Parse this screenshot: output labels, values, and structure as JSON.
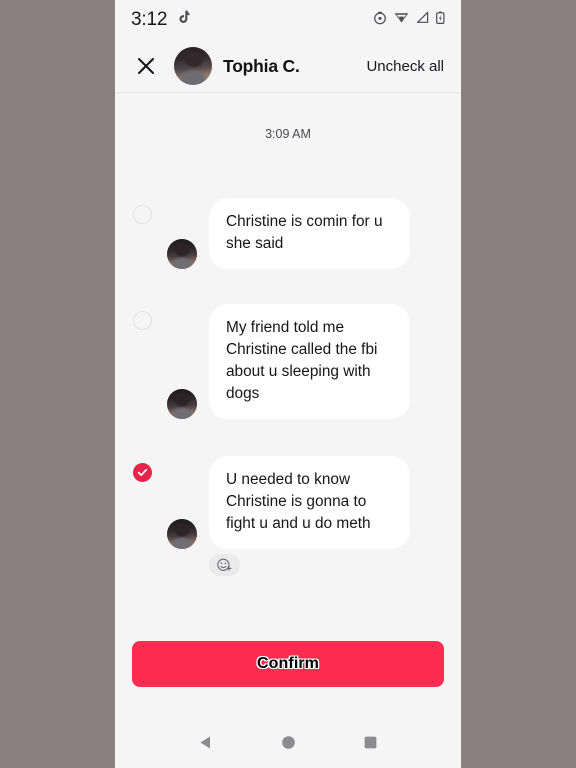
{
  "status_bar": {
    "time": "3:12",
    "app_icon": "tiktok-note-icon",
    "icons": [
      "alarm-icon",
      "wifi-icon",
      "cellular-signal-icon",
      "battery-icon"
    ]
  },
  "header": {
    "close_icon": "close-icon",
    "avatar": "contact-avatar",
    "title": "Tophia C.",
    "action_label": "Uncheck all"
  },
  "conversation": {
    "timestamp": "3:09 AM",
    "messages": [
      {
        "id": "message-1",
        "text": "Christine is comin for u she said",
        "checked": false,
        "avatar": "sender-avatar",
        "has_reaction_button": false
      },
      {
        "id": "message-2",
        "text": "My friend told me Christine called the fbi about u sleeping with dogs",
        "checked": false,
        "avatar": "sender-avatar",
        "has_reaction_button": false
      },
      {
        "id": "message-3",
        "text": "U needed to know Christine is gonna to fight u and u do meth",
        "checked": true,
        "avatar": "sender-avatar",
        "has_reaction_button": true,
        "reaction_icon": "add-reaction-icon"
      }
    ]
  },
  "footer": {
    "confirm_label": "Confirm"
  },
  "nav_bar": {
    "back_icon": "back-triangle-icon",
    "home_icon": "home-circle-icon",
    "recents_icon": "recents-square-icon"
  },
  "colors": {
    "accent": "#fb2c4f",
    "checked": "#e8234a",
    "chat_background": "#f6f5f5",
    "bubble": "#ffffff",
    "page_background": "#89807f"
  }
}
